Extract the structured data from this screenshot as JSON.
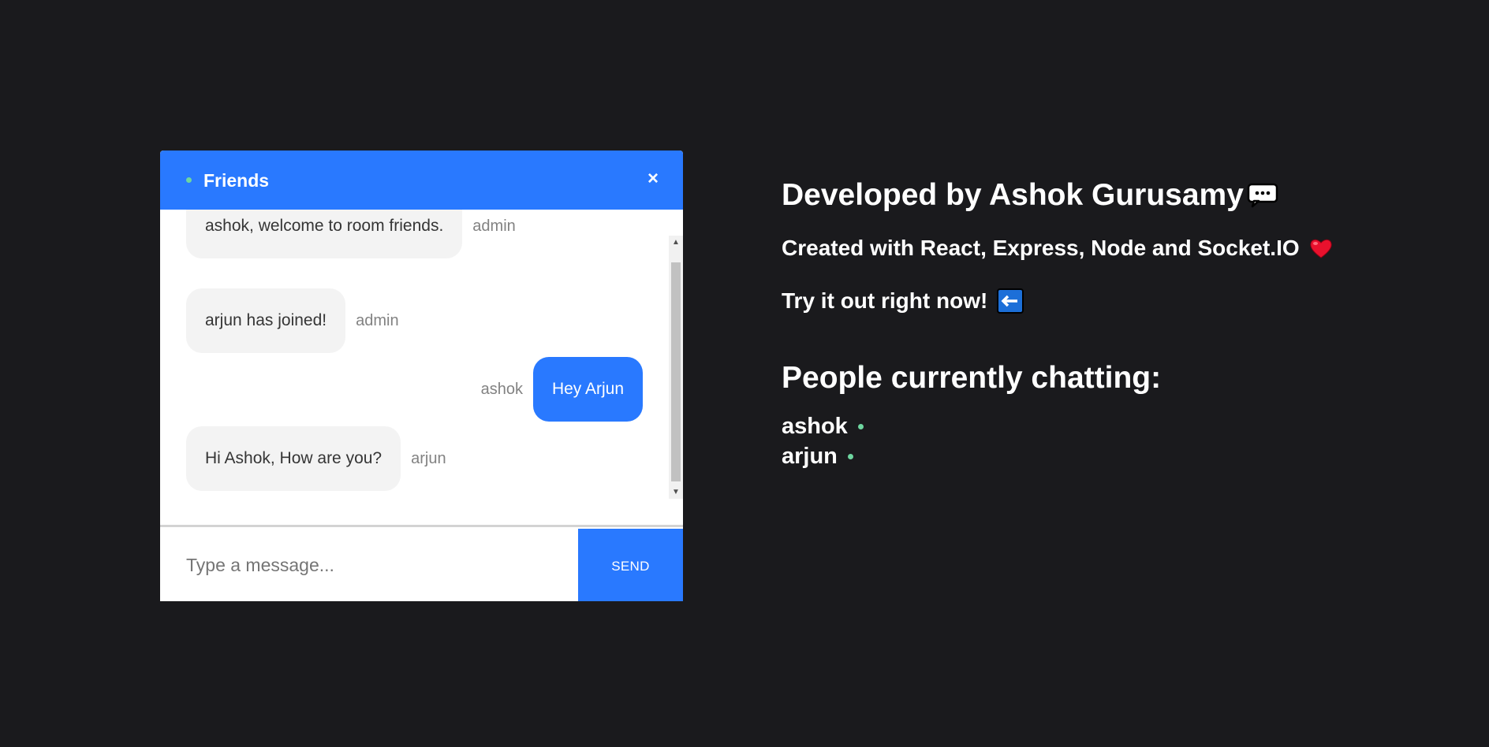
{
  "chat": {
    "room_name": "Friends",
    "close_label": "×",
    "messages": [
      {
        "text": "ashok, welcome to room friends.",
        "sender": "admin",
        "mine": false
      },
      {
        "text": "arjun has joined!",
        "sender": "admin",
        "mine": false
      },
      {
        "text": "Hey Arjun",
        "sender": "ashok",
        "mine": true
      },
      {
        "text": "Hi Ashok, How are you?",
        "sender": "arjun",
        "mine": false
      }
    ],
    "input_placeholder": "Type a message...",
    "input_value": "",
    "send_label": "SEND",
    "scroll": {
      "up_icon": "▲",
      "down_icon": "▼"
    }
  },
  "info": {
    "developed_by": "Developed by Ashok Gurusamy",
    "created_with": "Created with React, Express, Node and Socket.IO",
    "try_it": "Try it out right now!",
    "people_title": "People currently chatting:",
    "people": [
      "ashok",
      "arjun"
    ]
  },
  "colors": {
    "accent": "#2979ff",
    "online": "#6ed6a0",
    "background": "#1a1a1d"
  }
}
